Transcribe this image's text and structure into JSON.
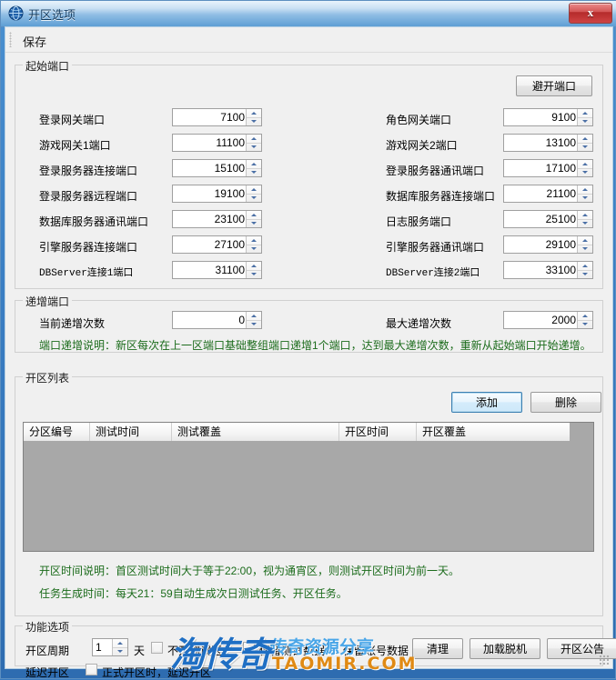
{
  "window": {
    "title": "开区选项",
    "icon": "globe-icon",
    "close_label": "x"
  },
  "toolbar": {
    "save_label": "保存"
  },
  "start_ports": {
    "title": "起始端口",
    "avoid_button": "避开端口",
    "fields_left": [
      {
        "label": "登录网关端口",
        "value": "7100",
        "mono": false
      },
      {
        "label": "游戏网关1端口",
        "value": "11100",
        "mono": false
      },
      {
        "label": "登录服务器连接端口",
        "value": "15100",
        "mono": false
      },
      {
        "label": "登录服务器远程端口",
        "value": "19100",
        "mono": false
      },
      {
        "label": "数据库服务器通讯端口",
        "value": "23100",
        "mono": false
      },
      {
        "label": "引擎服务器连接端口",
        "value": "27100",
        "mono": false
      },
      {
        "label": "DBServer连接1端口",
        "value": "31100",
        "mono": true
      }
    ],
    "fields_right": [
      {
        "label": "角色网关端口",
        "value": "9100",
        "mono": false
      },
      {
        "label": "游戏网关2端口",
        "value": "13100",
        "mono": false
      },
      {
        "label": "登录服务器通讯端口",
        "value": "17100",
        "mono": false
      },
      {
        "label": "数据库服务器连接端口",
        "value": "21100",
        "mono": false
      },
      {
        "label": "日志服务端口",
        "value": "25100",
        "mono": false
      },
      {
        "label": "引擎服务器通讯端口",
        "value": "29100",
        "mono": false
      },
      {
        "label": "DBServer连接2端口",
        "value": "33100",
        "mono": true
      }
    ]
  },
  "increment_ports": {
    "title": "递增端口",
    "current_label": "当前递增次数",
    "current_value": "0",
    "max_label": "最大递增次数",
    "max_value": "2000",
    "note": "端口递增说明：新区每次在上一区端口基础整组端口递增1个端口，达到最大递增次数，重新从起始端口开始递增。"
  },
  "zone_list": {
    "title": "开区列表",
    "add_button": "添加",
    "delete_button": "删除",
    "columns": [
      "分区编号",
      "测试时间",
      "测试覆盖",
      "开区时间",
      "开区覆盖"
    ],
    "rows": []
  },
  "time_notes": {
    "line1": "开区时间说明：首区测试时间大于等于22:00，视为通宵区，则测试开区时间为前一天。",
    "line2": "任务生成时间：每天21：59自动生成次日测试任务、开区任务。"
  },
  "function_options": {
    "title": "功能选项",
    "cycle_label": "开区周期",
    "cycle_value": "1",
    "day_unit": "天",
    "checkboxes": [
      {
        "label": "不开测试区",
        "checked": false
      },
      {
        "label": "保留测试数据",
        "checked": false
      },
      {
        "label": "保留账号数据",
        "checked": true
      }
    ],
    "buttons": [
      "清理",
      "加载脱机",
      "开区公告"
    ],
    "delay_label": "延迟开区",
    "delay_checkbox_checked": false,
    "delay_text": "正式开区时，延迟开区"
  },
  "watermark": {
    "main": "淘传奇",
    "sub": "传奇资源分享",
    "domain": "TAOMIR.COM"
  },
  "colors": {
    "note_green": "#1b6b1b",
    "title_blue": "#123a5e",
    "focus_blue": "#3c7fb1"
  }
}
